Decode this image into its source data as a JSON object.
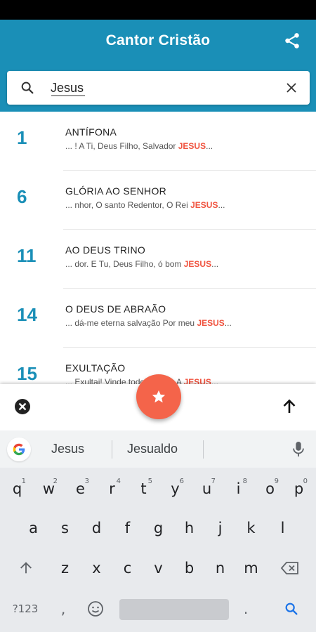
{
  "app": {
    "title": "Cantor Cristão",
    "share_icon": "share-icon"
  },
  "search": {
    "value": "Jesus",
    "search_icon": "search-icon",
    "clear_icon": "close-icon"
  },
  "colors": {
    "primary": "#1a8fb7",
    "accent": "#f4644a",
    "highlight": "#f0533f"
  },
  "results": [
    {
      "number": "1",
      "title": "ANTÍFONA",
      "prefix": "... ! A Ti, Deus Filho, Salvador ",
      "match": "JESUS",
      "suffix": "..."
    },
    {
      "number": "6",
      "title": "GLÓRIA AO SENHOR",
      "prefix": "... nhor, O santo Redentor, O Rei ",
      "match": "JESUS",
      "suffix": "..."
    },
    {
      "number": "11",
      "title": "AO DEUS TRINO",
      "prefix": "... dor. E Tu, Deus Filho, ó bom ",
      "match": "JESUS",
      "suffix": "..."
    },
    {
      "number": "14",
      "title": "O DEUS DE ABRAÃO",
      "prefix": "... dá-me eterna salvação Por meu ",
      "match": "JESUS",
      "suffix": "..."
    },
    {
      "number": "15",
      "title": "EXULTAÇÃO",
      "prefix": "... Exultai! Vinde todos louvar A ",
      "match": "JESUS",
      "suffix": "..."
    }
  ],
  "bottom_bar": {
    "close_icon": "close-circle-icon",
    "up_icon": "arrow-up-icon",
    "fab_icon": "star-icon"
  },
  "keyboard": {
    "suggestions": [
      "Jesus",
      "Jesualdo"
    ],
    "row1": [
      {
        "k": "q",
        "n": "1"
      },
      {
        "k": "w",
        "n": "2"
      },
      {
        "k": "e",
        "n": "3"
      },
      {
        "k": "r",
        "n": "4"
      },
      {
        "k": "t",
        "n": "5"
      },
      {
        "k": "y",
        "n": "6"
      },
      {
        "k": "u",
        "n": "7"
      },
      {
        "k": "i",
        "n": "8"
      },
      {
        "k": "o",
        "n": "9"
      },
      {
        "k": "p",
        "n": "0"
      }
    ],
    "row2": [
      "a",
      "s",
      "d",
      "f",
      "g",
      "h",
      "j",
      "k",
      "l"
    ],
    "row3": [
      "z",
      "x",
      "c",
      "v",
      "b",
      "n",
      "m"
    ],
    "symbols_key": "?123",
    "comma_key": ",",
    "period_key": "."
  }
}
